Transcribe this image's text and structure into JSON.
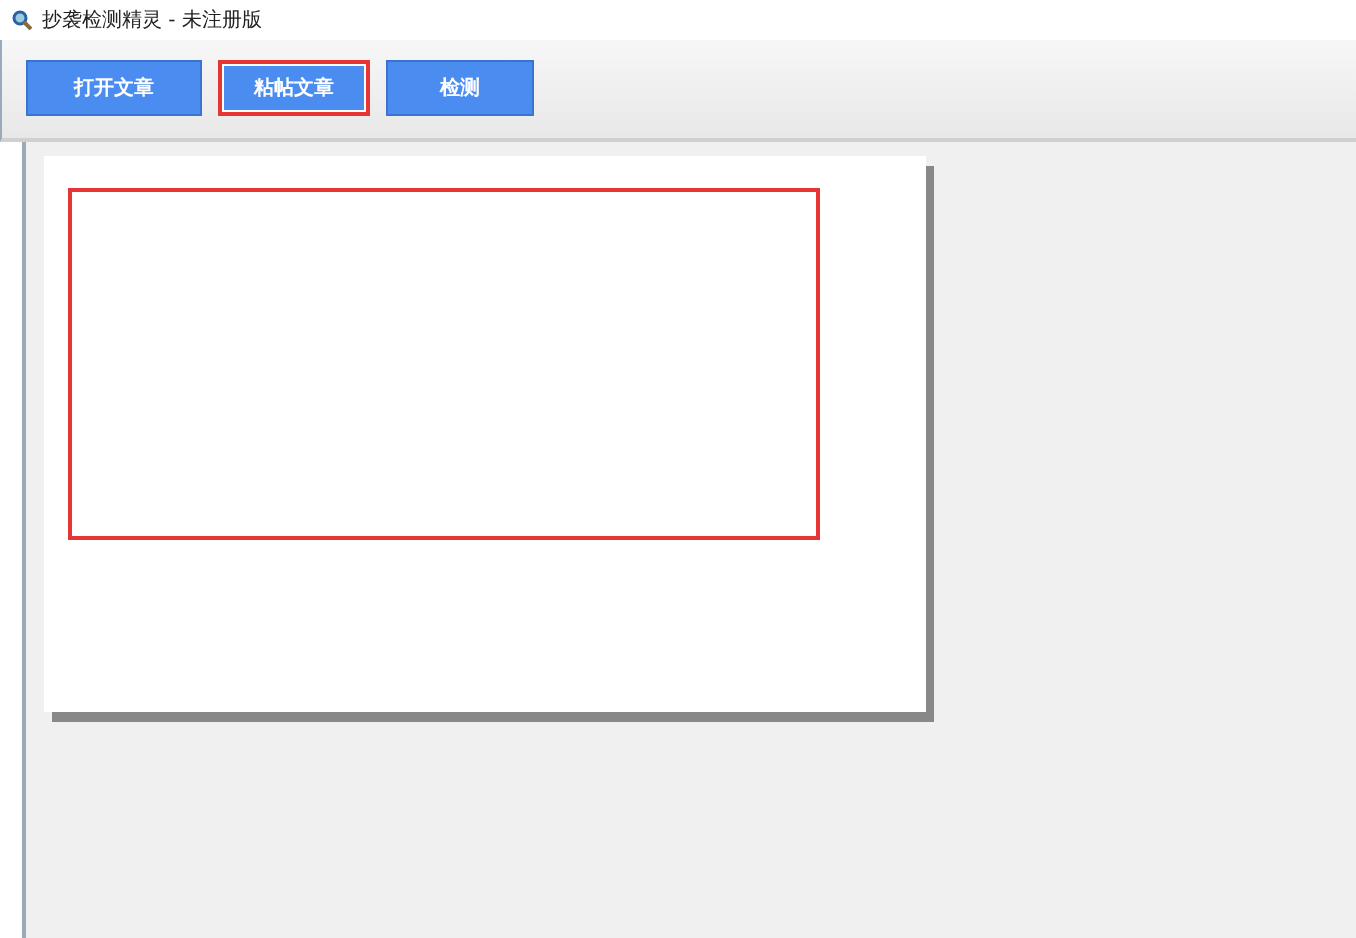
{
  "window": {
    "title": "抄袭检测精灵 - 未注册版"
  },
  "toolbar": {
    "buttons": [
      {
        "label": "打开文章",
        "highlighted": false
      },
      {
        "label": "粘帖文章",
        "highlighted": true
      },
      {
        "label": "检测",
        "highlighted": false
      }
    ]
  },
  "document": {
    "highlighted_region": true
  }
}
